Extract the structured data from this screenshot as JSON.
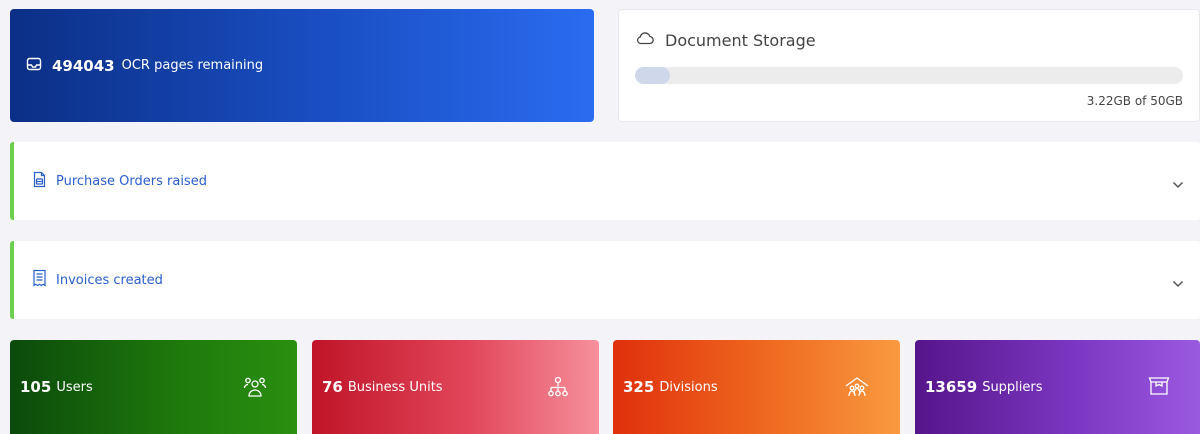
{
  "ocr": {
    "count": "494043",
    "label": "OCR pages remaining",
    "icon": "inbox-icon"
  },
  "storage": {
    "title": "Document Storage",
    "icon": "cloud-icon",
    "used_gb": 3.22,
    "total_gb": 50,
    "amount_text": "3.22GB of 50GB"
  },
  "panels": [
    {
      "label": "Purchase Orders raised",
      "icon": "purchase-order-icon"
    },
    {
      "label": "Invoices created",
      "icon": "receipt-icon"
    }
  ],
  "stats": [
    {
      "count": "105",
      "label": "Users",
      "icon": "users-icon",
      "color": "#1f7a0c"
    },
    {
      "count": "76",
      "label": "Business Units",
      "icon": "org-chart-icon",
      "color": "#e2465a"
    },
    {
      "count": "325",
      "label": "Divisions",
      "icon": "divisions-icon",
      "color": "#ef6a20"
    },
    {
      "count": "13659",
      "label": "Suppliers",
      "icon": "box-icon",
      "color": "#7a36c0"
    }
  ]
}
